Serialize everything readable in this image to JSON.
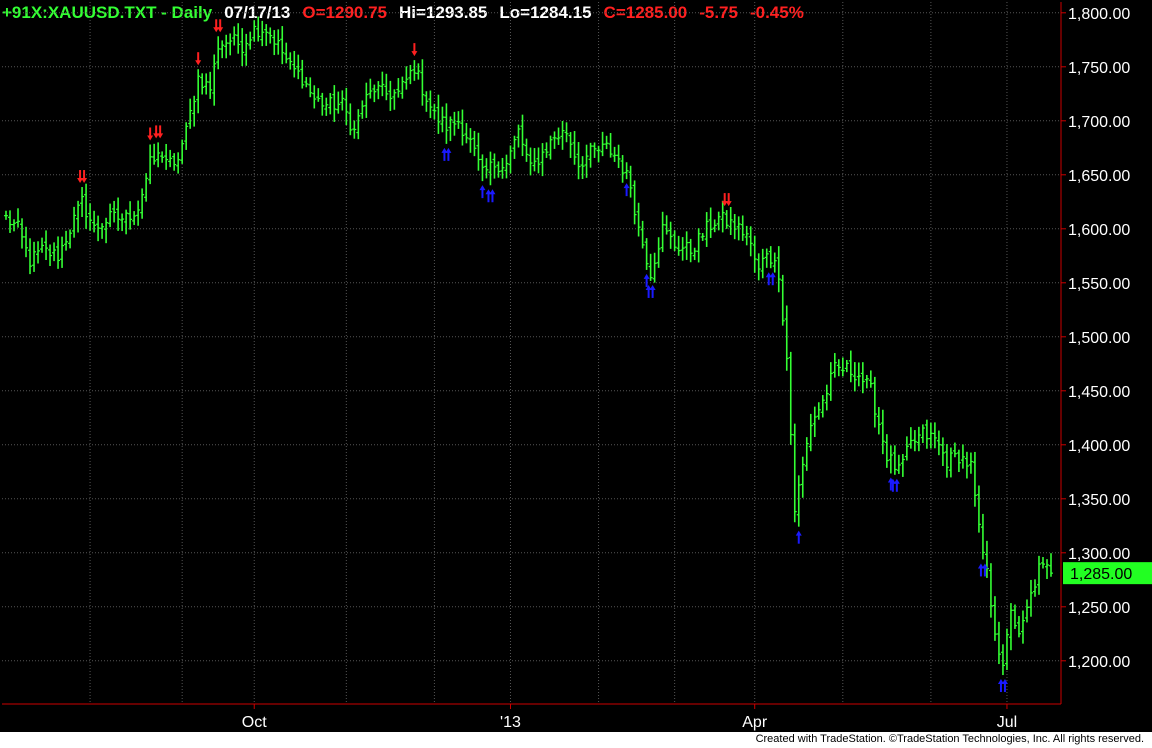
{
  "header": {
    "symbol": "+91X:XAUUSD.TXT - Daily",
    "date": "07/17/13",
    "open": "O=1290.75",
    "high": "Hi=1293.85",
    "low": "Lo=1284.15",
    "close": "C=1285.00",
    "change": "-5.75",
    "change_pct": "-0.45%"
  },
  "last_price_label": "1,285.00",
  "footer_text": "Created with TradeStation. ©TradeStation Technologies, Inc. All rights reserved.",
  "colors": {
    "background": "#000000",
    "bars": "#33ff33",
    "axis": "#cc0000",
    "grid": "#555555",
    "down_arrow": "#ff2020",
    "up_arrow": "#1a1aff",
    "last_price_bg": "#22ff22"
  },
  "chart_data": {
    "type": "bar",
    "title": "+91X:XAUUSD.TXT - Daily",
    "ylim": [
      1160,
      1810
    ],
    "y_ticks": [
      {
        "value": 1800,
        "label": "1,800.00"
      },
      {
        "value": 1750,
        "label": "1,750.00"
      },
      {
        "value": 1700,
        "label": "1,700.00"
      },
      {
        "value": 1650,
        "label": "1,650.00"
      },
      {
        "value": 1600,
        "label": "1,600.00"
      },
      {
        "value": 1550,
        "label": "1,550.00"
      },
      {
        "value": 1500,
        "label": "1,500.00"
      },
      {
        "value": 1450,
        "label": "1,450.00"
      },
      {
        "value": 1400,
        "label": "1,400.00"
      },
      {
        "value": 1350,
        "label": "1,350.00"
      },
      {
        "value": 1300,
        "label": "1,300.00"
      },
      {
        "value": 1250,
        "label": "1,250.00"
      },
      {
        "value": 1200,
        "label": "1,200.00"
      }
    ],
    "x_ticks": [
      {
        "index": 62,
        "label": "Oct"
      },
      {
        "index": 126,
        "label": "'13"
      },
      {
        "index": 187,
        "label": "Apr"
      },
      {
        "index": 250,
        "label": "Jul"
      }
    ],
    "x_gridlines": [
      21,
      44,
      62,
      85,
      107,
      126,
      148,
      167,
      187,
      209,
      231,
      250
    ],
    "n_bars": 262,
    "close_path": [
      [
        0,
        1610
      ],
      [
        3,
        1600
      ],
      [
        6,
        1570
      ],
      [
        9,
        1580
      ],
      [
        13,
        1575
      ],
      [
        16,
        1600
      ],
      [
        19,
        1625
      ],
      [
        22,
        1600
      ],
      [
        26,
        1610
      ],
      [
        30,
        1610
      ],
      [
        33,
        1620
      ],
      [
        36,
        1660
      ],
      [
        39,
        1670
      ],
      [
        42,
        1655
      ],
      [
        45,
        1690
      ],
      [
        48,
        1740
      ],
      [
        51,
        1730
      ],
      [
        53,
        1770
      ],
      [
        56,
        1775
      ],
      [
        59,
        1770
      ],
      [
        62,
        1785
      ],
      [
        65,
        1785
      ],
      [
        68,
        1770
      ],
      [
        71,
        1750
      ],
      [
        74,
        1740
      ],
      [
        77,
        1720
      ],
      [
        80,
        1715
      ],
      [
        84,
        1715
      ],
      [
        87,
        1690
      ],
      [
        89,
        1715
      ],
      [
        92,
        1730
      ],
      [
        95,
        1725
      ],
      [
        98,
        1725
      ],
      [
        102,
        1750
      ],
      [
        104,
        1730
      ],
      [
        107,
        1705
      ],
      [
        110,
        1695
      ],
      [
        113,
        1700
      ],
      [
        116,
        1680
      ],
      [
        119,
        1650
      ],
      [
        122,
        1660
      ],
      [
        125,
        1660
      ],
      [
        128,
        1690
      ],
      [
        131,
        1655
      ],
      [
        134,
        1670
      ],
      [
        137,
        1685
      ],
      [
        140,
        1690
      ],
      [
        143,
        1660
      ],
      [
        146,
        1670
      ],
      [
        150,
        1675
      ],
      [
        153,
        1665
      ],
      [
        156,
        1640
      ],
      [
        158,
        1600
      ],
      [
        161,
        1560
      ],
      [
        164,
        1600
      ],
      [
        167,
        1585
      ],
      [
        171,
        1580
      ],
      [
        175,
        1600
      ],
      [
        178,
        1610
      ],
      [
        181,
        1605
      ],
      [
        185,
        1595
      ],
      [
        188,
        1560
      ],
      [
        190,
        1580
      ],
      [
        193,
        1560
      ],
      [
        195,
        1480
      ],
      [
        197,
        1340
      ],
      [
        199,
        1380
      ],
      [
        201,
        1420
      ],
      [
        204,
        1440
      ],
      [
        207,
        1470
      ],
      [
        210,
        1470
      ],
      [
        213,
        1465
      ],
      [
        216,
        1450
      ],
      [
        218,
        1420
      ],
      [
        220,
        1390
      ],
      [
        223,
        1375
      ],
      [
        226,
        1400
      ],
      [
        229,
        1410
      ],
      [
        232,
        1405
      ],
      [
        235,
        1385
      ],
      [
        238,
        1390
      ],
      [
        241,
        1380
      ],
      [
        243,
        1320
      ],
      [
        245,
        1280
      ],
      [
        247,
        1230
      ],
      [
        249,
        1190
      ],
      [
        251,
        1250
      ],
      [
        253,
        1220
      ],
      [
        256,
        1260
      ],
      [
        258,
        1285
      ],
      [
        261,
        1285
      ]
    ],
    "down_arrows": [
      {
        "index": 19,
        "count": 2
      },
      {
        "index": 36,
        "count": 1
      },
      {
        "index": 38,
        "count": 2
      },
      {
        "index": 48,
        "count": 1
      },
      {
        "index": 53,
        "count": 2
      },
      {
        "index": 102,
        "count": 1
      },
      {
        "index": 180,
        "count": 2
      }
    ],
    "up_arrows": [
      {
        "index": 110,
        "count": 2
      },
      {
        "index": 119,
        "count": 1
      },
      {
        "index": 121,
        "count": 2
      },
      {
        "index": 155,
        "count": 1
      },
      {
        "index": 160,
        "count": 1
      },
      {
        "index": 161,
        "count": 2
      },
      {
        "index": 191,
        "count": 2
      },
      {
        "index": 198,
        "count": 1
      },
      {
        "index": 221,
        "count": 1
      },
      {
        "index": 222,
        "count": 2
      },
      {
        "index": 244,
        "count": 2
      },
      {
        "index": 249,
        "count": 2
      }
    ]
  }
}
